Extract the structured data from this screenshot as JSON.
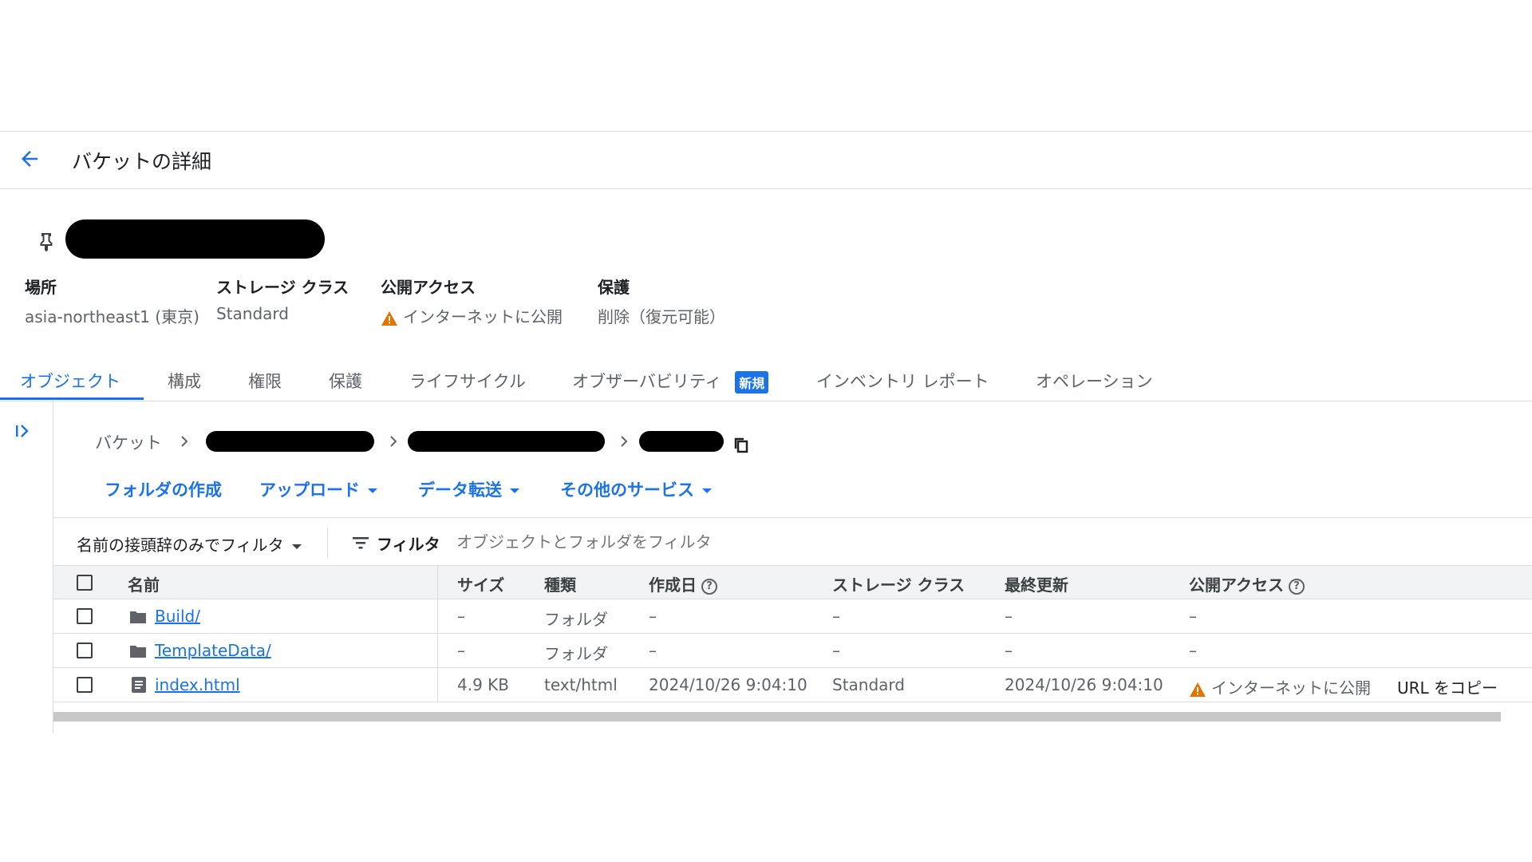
{
  "header": {
    "title": "バケットの詳細"
  },
  "bucket": {
    "info": [
      {
        "label": "場所",
        "value": "asia-northeast1 (東京)"
      },
      {
        "label": "ストレージ クラス",
        "value": "Standard"
      },
      {
        "label": "公開アクセス",
        "value": "インターネットに公開"
      },
      {
        "label": "保護",
        "value": "削除（復元可能）"
      }
    ]
  },
  "tabs": [
    {
      "label": "オブジェクト"
    },
    {
      "label": "構成"
    },
    {
      "label": "権限"
    },
    {
      "label": "保護"
    },
    {
      "label": "ライフサイクル"
    },
    {
      "label": "オブザーバビリティ",
      "badge": "新規"
    },
    {
      "label": "インベントリ レポート"
    },
    {
      "label": "オペレーション"
    }
  ],
  "breadcrumb": {
    "root": "バケット"
  },
  "actions": {
    "create_folder": "フォルダの作成",
    "upload": "アップロード",
    "transfer": "データ転送",
    "other": "その他のサービス"
  },
  "filter": {
    "prefix_select": "名前の接頭辞のみでフィルタ",
    "label": "フィルタ",
    "placeholder": "オブジェクトとフォルダをフィルタ"
  },
  "table": {
    "columns": [
      "名前",
      "サイズ",
      "種類",
      "作成日",
      "ストレージ クラス",
      "最終更新",
      "公開アクセス"
    ],
    "rows": [
      {
        "name": "Build/",
        "size": "–",
        "type": "フォルダ",
        "created": "–",
        "class": "–",
        "updated": "–",
        "access": "–"
      },
      {
        "name": "TemplateData/",
        "size": "–",
        "type": "フォルダ",
        "created": "–",
        "class": "–",
        "updated": "–",
        "access": "–"
      },
      {
        "name": "index.html",
        "size": "4.9 KB",
        "type": "text/html",
        "created": "2024/10/26 9:04:10",
        "class": "Standard",
        "updated": "2024/10/26 9:04:10",
        "access": "インターネットに公開",
        "action": "URL をコピー"
      }
    ]
  },
  "colors": {
    "accent": "#1a73e8",
    "warning": "#e37400",
    "redacted": "#000000"
  }
}
